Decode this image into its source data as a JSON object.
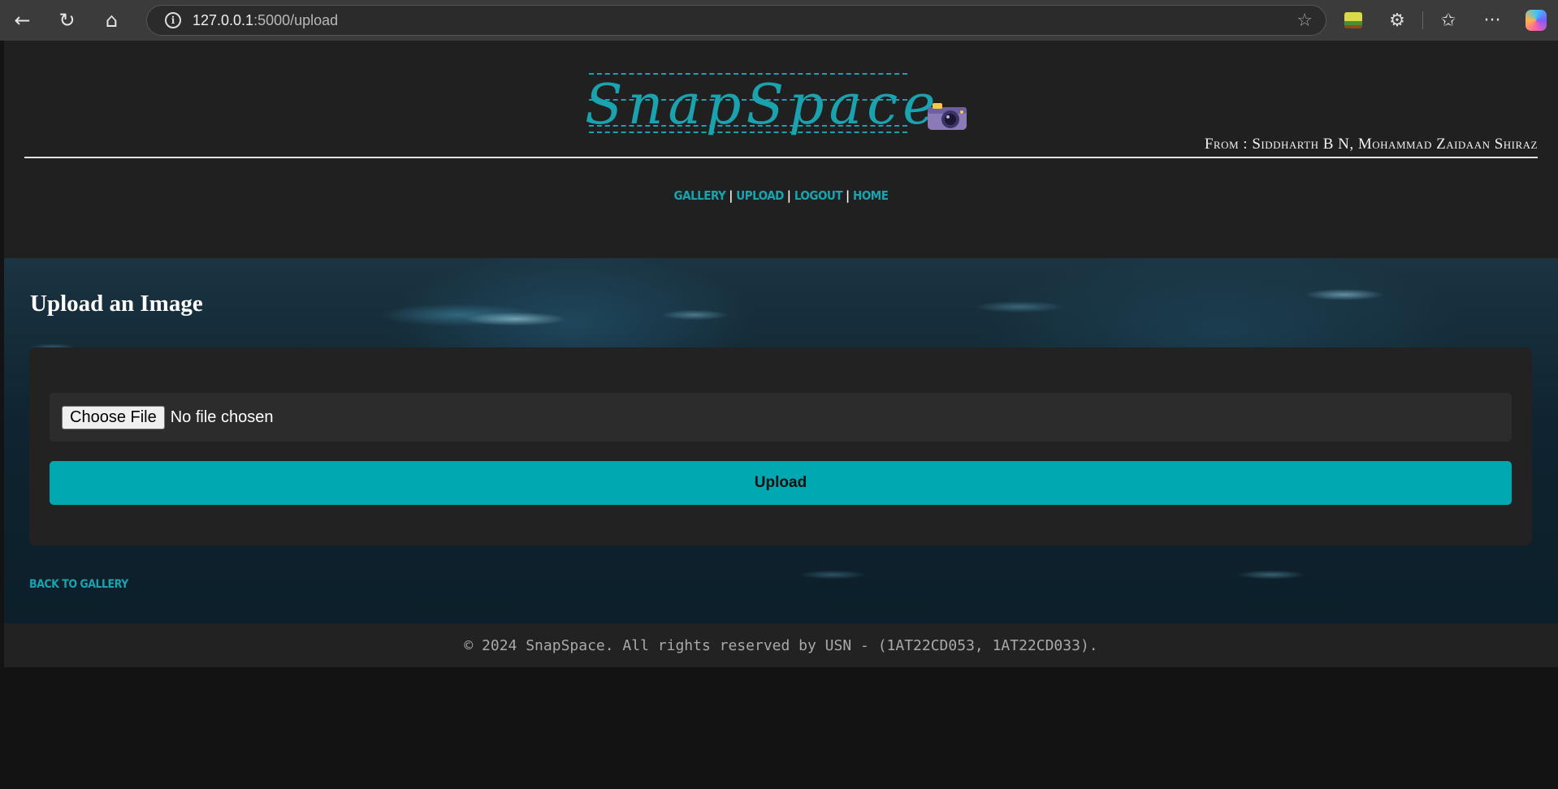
{
  "browser": {
    "url_host": "127.0.0.1",
    "url_path": ":5000/upload",
    "icons": [
      "back-arrow-icon",
      "reload-icon",
      "home-icon",
      "site-info-icon",
      "favorite-star-icon",
      "extension-icon",
      "puzzle-icon",
      "favorites-icon",
      "more-icon",
      "copilot-icon"
    ]
  },
  "header": {
    "logo_text": "SnapSpace",
    "logo_emoji": "📸",
    "authors": "From : Siddharth B N, Mohammad Zaidaan Shiraz"
  },
  "nav": {
    "items": [
      {
        "label": "Gallery"
      },
      {
        "label": "Upload"
      },
      {
        "label": "Logout"
      },
      {
        "label": "Home"
      }
    ],
    "separator": "|"
  },
  "upload": {
    "title": "Upload an Image",
    "choose_file_label": "Choose File",
    "file_status": "No file chosen",
    "submit_label": "Upload",
    "back_link": "Back to Gallery"
  },
  "footer": {
    "text": "© 2024 SnapSpace. All rights reserved by USN - (1AT22CD053, 1AT22CD033)."
  },
  "colors": {
    "accent": "#1aa3ae",
    "button": "#00a8b2",
    "header_bg": "#202020",
    "card_bg": "#222222"
  }
}
